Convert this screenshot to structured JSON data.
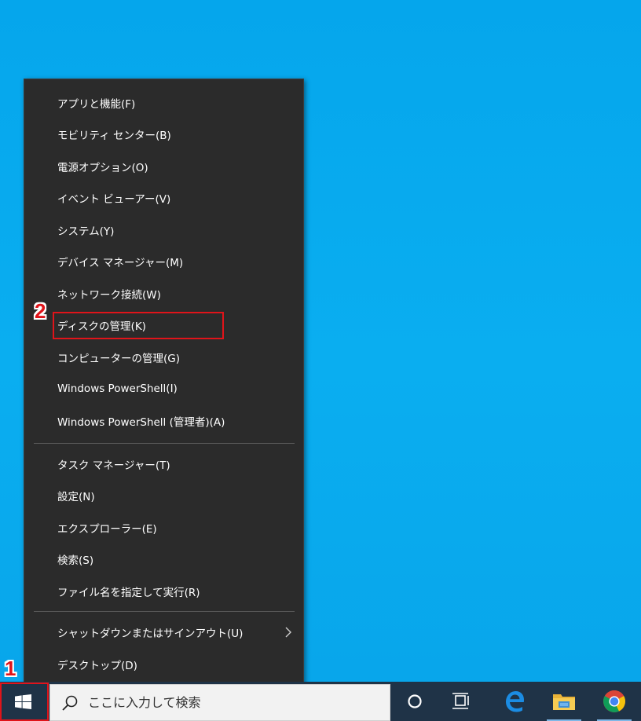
{
  "menu": {
    "items": [
      {
        "label": "アプリと機能(F)"
      },
      {
        "label": "モビリティ センター(B)"
      },
      {
        "label": "電源オプション(O)"
      },
      {
        "label": "イベント ビューアー(V)"
      },
      {
        "label": "システム(Y)"
      },
      {
        "label": "デバイス マネージャー(M)"
      },
      {
        "label": "ネットワーク接続(W)"
      },
      {
        "label": "ディスクの管理(K)"
      },
      {
        "label": "コンピューターの管理(G)"
      },
      {
        "label": "Windows PowerShell(I)"
      },
      {
        "label": "Windows PowerShell (管理者)(A)"
      },
      {
        "label": "タスク マネージャー(T)"
      },
      {
        "label": "設定(N)"
      },
      {
        "label": "エクスプローラー(E)"
      },
      {
        "label": "検索(S)"
      },
      {
        "label": "ファイル名を指定して実行(R)"
      },
      {
        "label": "シャットダウンまたはサインアウト(U)"
      },
      {
        "label": "デスクトップ(D)"
      }
    ]
  },
  "annotations": {
    "step1": "1",
    "step2": "2",
    "color": "#e0141a"
  },
  "taskbar": {
    "search_placeholder": "ここに入力して検索",
    "icons": [
      "windows-start-icon",
      "search-icon",
      "cortana-icon",
      "task-view-icon",
      "edge-icon",
      "file-explorer-icon",
      "chrome-icon"
    ]
  }
}
